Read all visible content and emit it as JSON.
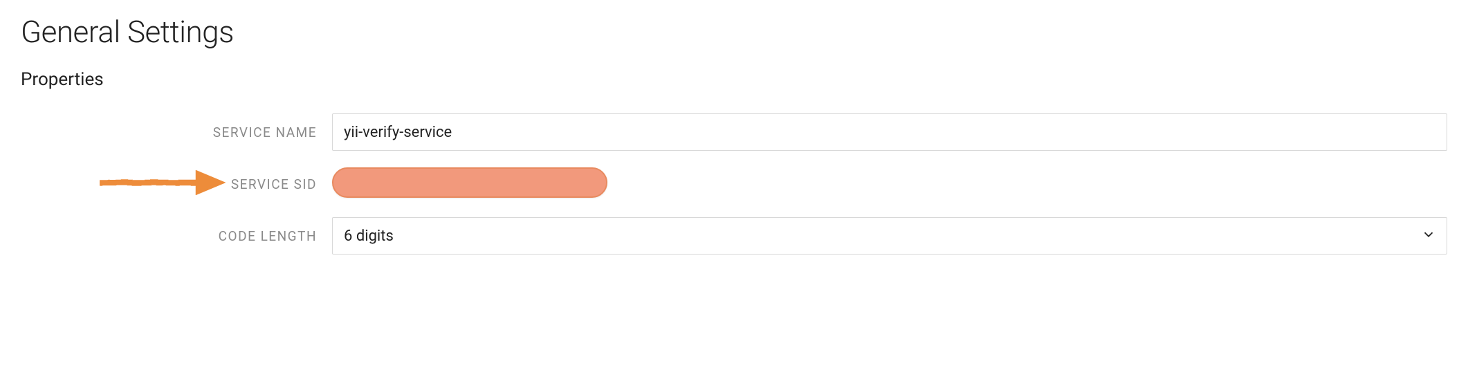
{
  "page": {
    "title": "General Settings",
    "section": "Properties"
  },
  "fields": {
    "service_name": {
      "label": "SERVICE NAME",
      "value": "yii-verify-service"
    },
    "service_sid": {
      "label": "SERVICE SID",
      "value": ""
    },
    "code_length": {
      "label": "CODE LENGTH",
      "value": "6 digits"
    }
  },
  "annotation": {
    "arrow_color": "#ed8c3a"
  }
}
